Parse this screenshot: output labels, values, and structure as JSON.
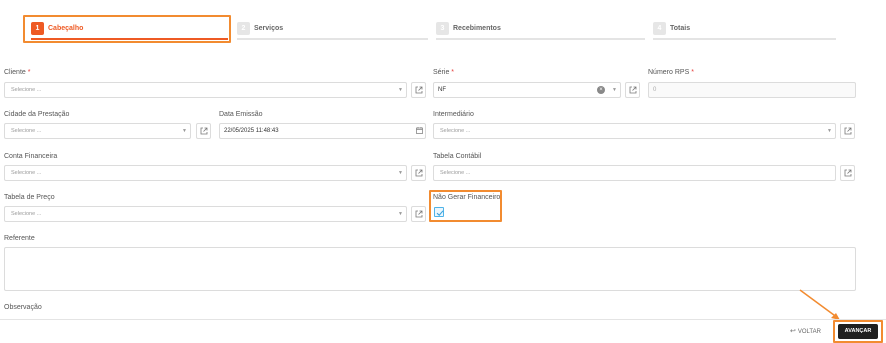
{
  "stepper": {
    "steps": [
      {
        "number": "1",
        "label": "Cabeçalho"
      },
      {
        "number": "2",
        "label": "Serviços"
      },
      {
        "number": "3",
        "label": "Recebimentos"
      },
      {
        "number": "4",
        "label": "Totais"
      }
    ],
    "active_step": 1
  },
  "form": {
    "cliente": {
      "label": "Cliente",
      "required_mark": "*",
      "placeholder": "Selecione ..."
    },
    "serie": {
      "label": "Série",
      "required_mark": "*",
      "value": "NF"
    },
    "numero_rps": {
      "label": "Número RPS",
      "required_mark": "*",
      "value": "0"
    },
    "cidade_prestacao": {
      "label": "Cidade da Prestação",
      "placeholder": "Selecione ..."
    },
    "data_emissao": {
      "label": "Data Emissão",
      "value": "22/05/2025 11:48:43"
    },
    "intermediario": {
      "label": "Intermediário",
      "placeholder": "Selecione ..."
    },
    "conta_financeira": {
      "label": "Conta Financeira",
      "placeholder": "Selecione ..."
    },
    "tabela_contabil": {
      "label": "Tabela Contábil",
      "placeholder": "Selecione ..."
    },
    "tabela_preco": {
      "label": "Tabela de Preço",
      "placeholder": "Selecione ..."
    },
    "nao_gerar_financeiro": {
      "label": "Não Gerar Financeiro",
      "checked": true
    },
    "referente": {
      "label": "Referente",
      "value": ""
    },
    "observacao": {
      "label": "Observação"
    }
  },
  "footer": {
    "back_label": "VOLTAR",
    "next_label": "AVANÇAR"
  },
  "colors": {
    "accent": "#ee5a24",
    "highlight": "#f28b30",
    "primary_button": "#1f1f1f",
    "checkbox": "#4fb3e8"
  }
}
